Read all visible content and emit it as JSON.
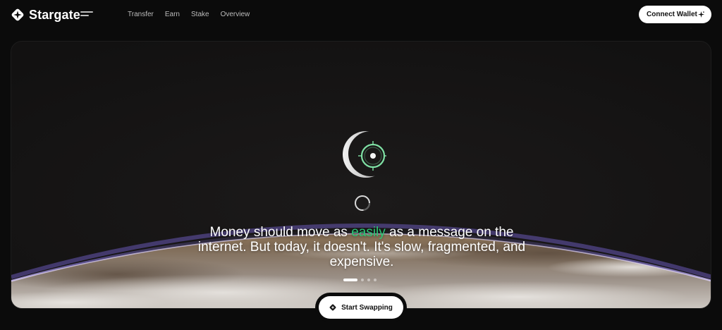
{
  "brand": {
    "name": "Stargate",
    "logo_icon": "stargate-diamond-logo"
  },
  "nav": {
    "menu_icon": "hamburger-menu-icon",
    "items": [
      {
        "label": "Transfer"
      },
      {
        "label": "Earn"
      },
      {
        "label": "Stake"
      },
      {
        "label": "Overview"
      }
    ]
  },
  "header": {
    "connect_label": "Connect Wallet",
    "connect_icon": "sparkle-icon"
  },
  "hero": {
    "headline_before": "Money should move as ",
    "headline_accent": "easily",
    "headline_after": " as a message on the",
    "headline_line2": "internet. But today, it doesn't. It's slow, fragmented, and",
    "headline_line3": "expensive.",
    "accent_color": "#2bc776",
    "slides_total": 4,
    "slide_active": 1,
    "cta_label": "Start Swapping",
    "cta_icon": "stargate-diamond-icon"
  },
  "colors": {
    "background": "#0b0b0b",
    "accent": "#2bc776",
    "button_bg": "#ffffff"
  }
}
